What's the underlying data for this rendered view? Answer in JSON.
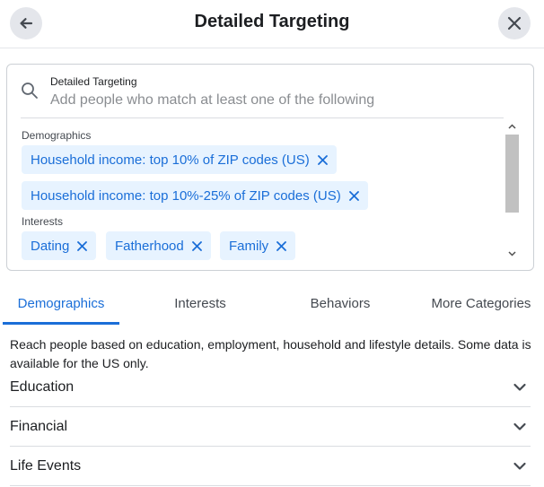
{
  "header": {
    "title": "Detailed Targeting",
    "back_icon": "arrow-left-icon",
    "close_icon": "close-icon"
  },
  "search": {
    "label": "Detailed Targeting",
    "placeholder": "Add people who match at least one of the following",
    "value": ""
  },
  "selections": {
    "demographics_label": "Demographics",
    "demographics": [
      "Household income: top 10% of ZIP codes (US)",
      "Household income: top 10%-25% of ZIP codes (US)"
    ],
    "interests_label": "Interests",
    "interests": [
      "Dating",
      "Fatherhood",
      "Family"
    ]
  },
  "tabs": [
    {
      "label": "Demographics",
      "active": true
    },
    {
      "label": "Interests",
      "active": false
    },
    {
      "label": "Behaviors",
      "active": false
    },
    {
      "label": "More Categories",
      "active": false
    }
  ],
  "description": "Reach people based on education, employment, household and lifestyle details. Some data is available for the US only.",
  "categories": [
    {
      "label": "Education"
    },
    {
      "label": "Financial"
    },
    {
      "label": "Life Events"
    }
  ],
  "colors": {
    "accent": "#1a6ed8",
    "chip_bg": "#e7f3ff"
  }
}
